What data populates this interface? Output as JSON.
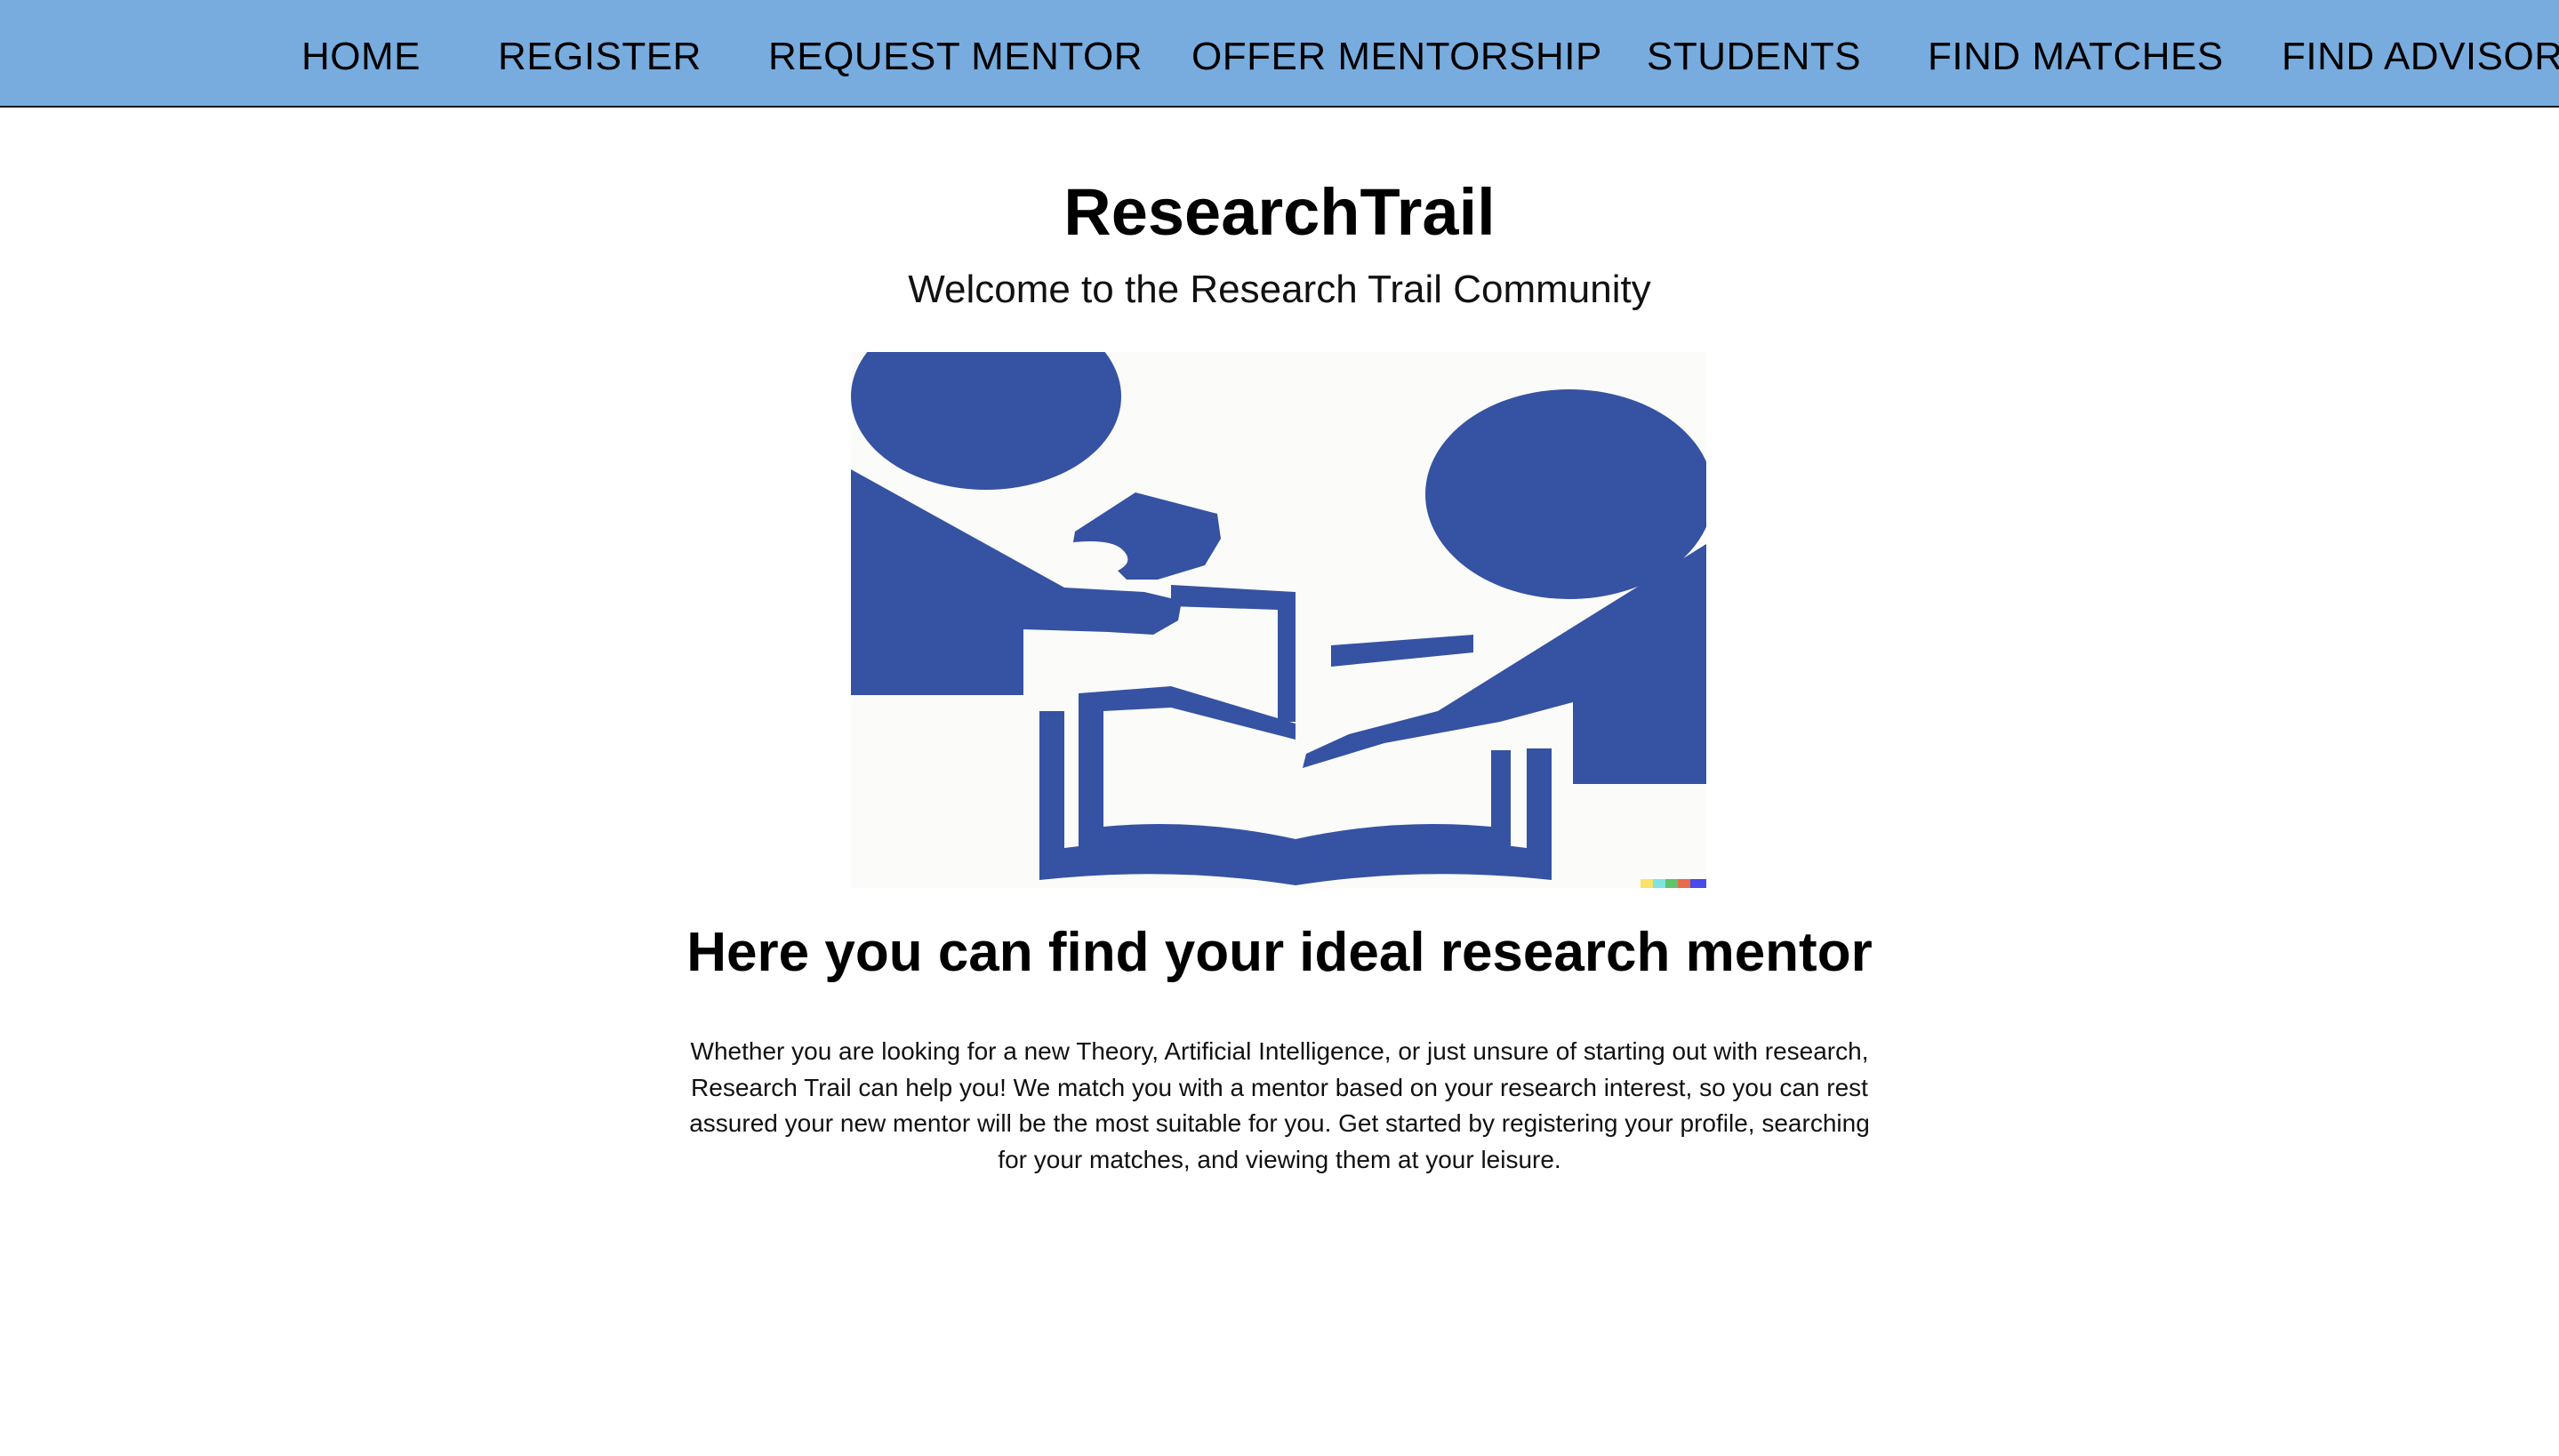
{
  "nav": {
    "items": [
      {
        "label": "HOME"
      },
      {
        "label": "REGISTER"
      },
      {
        "label": "REQUEST MENTOR"
      },
      {
        "label": "OFFER MENTORSHIP"
      },
      {
        "label": "STUDENTS"
      },
      {
        "label": "FIND MATCHES"
      },
      {
        "label": "FIND ADVISOR"
      }
    ]
  },
  "header": {
    "title": "ResearchTrail",
    "welcome": "Welcome to the Research Trail Community"
  },
  "hero": {
    "icon": "mentorship-illustration"
  },
  "main": {
    "tagline": "Here you can find your ideal research mentor",
    "intro": "Whether you are looking for a new Theory, Artificial Intelligence, or just unsure of starting out with research, Research Trail can help you! We match you with a mentor based on your research interest, so you can rest assured your new mentor will be the most suitable for you. Get started by registering your profile, searching for your matches, and viewing them at your leisure."
  },
  "colors": {
    "nav_background": "#78acdf",
    "illustration_blue": "#3552a3",
    "page_background": "#ffffff"
  }
}
